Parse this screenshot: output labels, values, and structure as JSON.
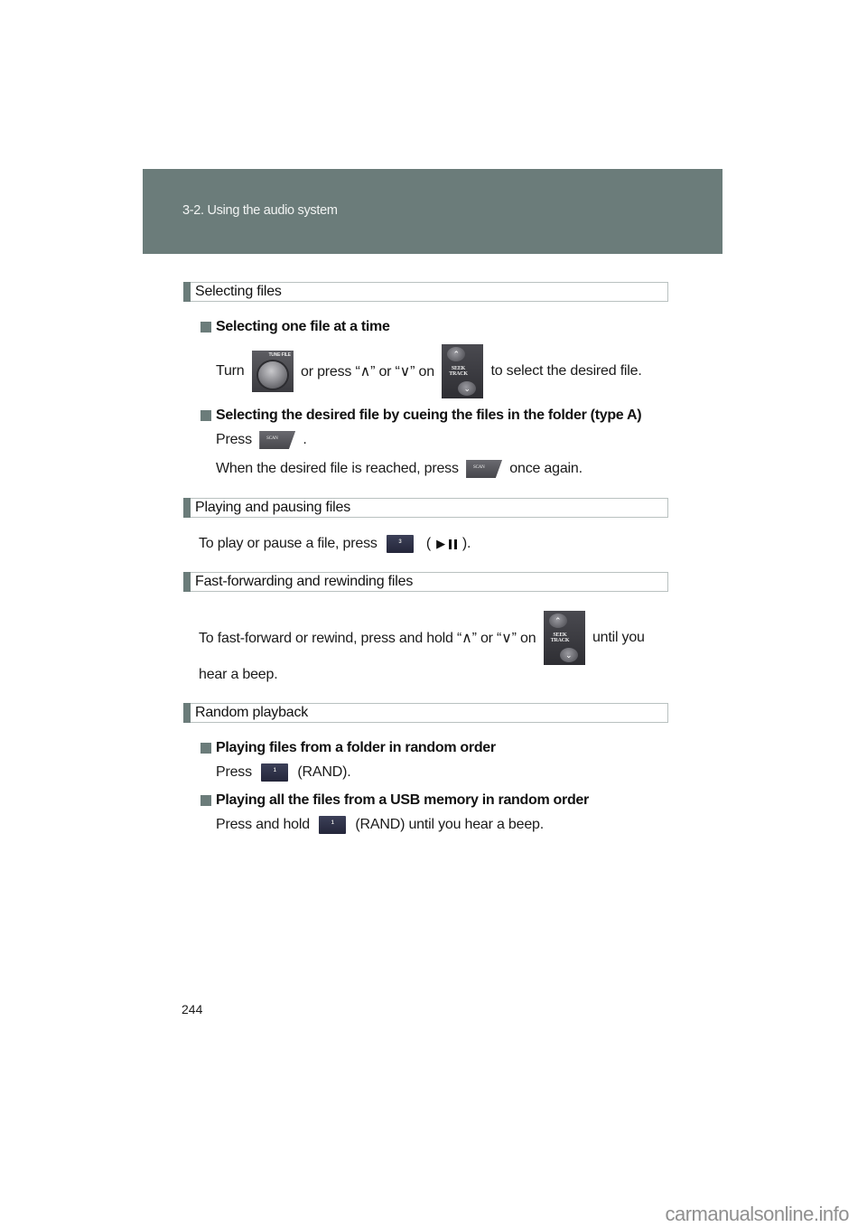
{
  "header": {
    "chapter": "3-2. Using the audio system"
  },
  "sections": [
    {
      "title": "Selecting files",
      "subsections": [
        {
          "title": "Selecting one file at a time",
          "line1": {
            "part1": "Turn ",
            "knob_label": "TUNE·FILE",
            "part2": " or press “∧” or “∨” on ",
            "seek_label_1": "SEEK",
            "seek_label_2": "TRACK",
            "part3": " to select the desired file."
          }
        },
        {
          "title": "Selecting the desired file by cueing the files in the folder (type A)",
          "line1": {
            "part1": "Press ",
            "scan_label": "SCAN",
            "part2": " ."
          },
          "line2": {
            "part1": "When the desired file is reached, press ",
            "scan_label": "SCAN",
            "part2": " once again."
          }
        }
      ]
    },
    {
      "title": "Playing and pausing files",
      "line1": {
        "part1": "To play or pause a file, press ",
        "button_label": "3",
        "open_paren": "(",
        "close_paren": ")."
      }
    },
    {
      "title": "Fast-forwarding and rewinding files",
      "line1": {
        "part1": "To fast-forward or rewind, press and hold “∧” or “∨” on ",
        "seek_label_1": "SEEK",
        "seek_label_2": "TRACK",
        "part2": " until you"
      },
      "line2": "hear a beep."
    },
    {
      "title": "Random playback",
      "subsections": [
        {
          "title": "Playing files from a folder in random order",
          "line1": {
            "part1": "Press ",
            "button_label": "1",
            "part2": " (RAND)."
          }
        },
        {
          "title": "Playing all the files from a USB memory in random order",
          "line1": {
            "part1": "Press and hold ",
            "button_label": "1",
            "part2": " (RAND) until you hear a beep."
          }
        }
      ]
    }
  ],
  "page_number": "244",
  "watermark": "carmanualsonline.info",
  "colors": {
    "accent": "#6b7c7a",
    "header_text": "#f2f4f3",
    "border": "#b9c1c0"
  }
}
